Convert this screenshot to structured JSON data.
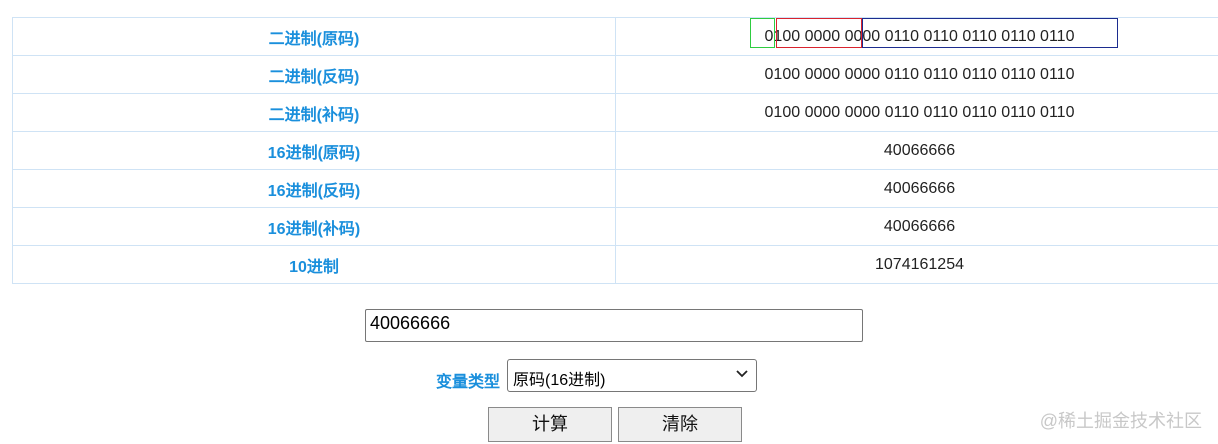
{
  "rows": [
    {
      "label": "二进制(原码)",
      "value": "0100 0000 0000 0110 0110 0110 0110 0110"
    },
    {
      "label": "二进制(反码)",
      "value": "0100 0000 0000 0110 0110 0110 0110 0110"
    },
    {
      "label": "二进制(补码)",
      "value": "0100 0000 0000 0110 0110 0110 0110 0110"
    },
    {
      "label": "16进制(原码)",
      "value": "40066666"
    },
    {
      "label": "16进制(反码)",
      "value": "40066666"
    },
    {
      "label": "16进制(补码)",
      "value": "40066666"
    },
    {
      "label": "10进制",
      "value": "1074161254"
    }
  ],
  "input": {
    "value": "40066666"
  },
  "type_field": {
    "label": "变量类型",
    "selected": "原码(16进制)"
  },
  "buttons": {
    "calculate": "计算",
    "clear": "清除"
  },
  "watermark": "@稀土掘金技术社区",
  "colors": {
    "label_blue": "#1a8fdc",
    "sign_highlight": "#2ecc40",
    "exponent_highlight": "#d9232e",
    "mantissa_highlight": "#1c2c8f"
  }
}
